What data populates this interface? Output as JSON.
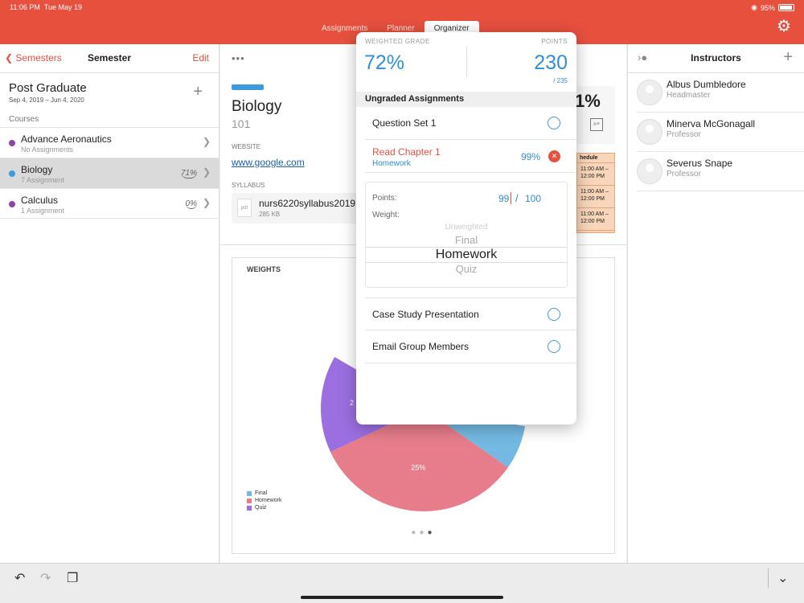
{
  "status": {
    "time": "11:06 PM",
    "date": "Tue May 19",
    "battery": "95%"
  },
  "tabs": [
    {
      "label": "Assignments",
      "active": false
    },
    {
      "label": "Planner",
      "active": false
    },
    {
      "label": "Organizer",
      "active": true
    }
  ],
  "left": {
    "back_label": "Semesters",
    "title": "Semester",
    "edit_label": "Edit",
    "semester_name": "Post Graduate",
    "semester_dates": "Sep 4, 2019 – Jun 4, 2020",
    "courses_header": "Courses",
    "courses": [
      {
        "name": "Advance Aeronautics",
        "sub": "No Assignments",
        "pct": "",
        "color": "#8e44ad",
        "selected": false
      },
      {
        "name": "Biology",
        "sub": "7 Assignment",
        "pct": "71%",
        "color": "#3d9bdc",
        "selected": true
      },
      {
        "name": "Calculus",
        "sub": "1 Assignment",
        "pct": "0%",
        "color": "#8e44ad",
        "selected": false
      }
    ]
  },
  "course": {
    "name": "Biology",
    "number": "101",
    "website_label": "WEBSITE",
    "website": "www.google.com",
    "syllabus_label": "SYLLABUS",
    "file_name": "nurs6220syllabus2019",
    "file_size": "285 KB",
    "file_type": "pdf",
    "grade_partial": "1%",
    "schedule_label": "hedule",
    "schedule_times": [
      "11:00 AM – 12:00 PM",
      "11:00 AM – 12:00 PM",
      "11:00 AM – 12:00 PM"
    ]
  },
  "chart_data": {
    "type": "pie",
    "title": "WEIGHTS",
    "categories": [
      "Final",
      "Homework",
      "Quiz"
    ],
    "colors": [
      "#74b9e3",
      "#e77d8b",
      "#9b6fe0"
    ],
    "slice_labels": [
      "",
      "25%",
      "2"
    ],
    "slices_visible_degrees": {
      "Final": [
        100,
        125
      ],
      "Homework": [
        125,
        245
      ],
      "Quiz": [
        245,
        300
      ]
    }
  },
  "right": {
    "title": "Instructors",
    "instructors": [
      {
        "name": "Albus Dumbledore",
        "role": "Headmaster"
      },
      {
        "name": "Minerva McGonagall",
        "role": "Professor"
      },
      {
        "name": "Severus Snape",
        "role": "Professor"
      }
    ]
  },
  "popover": {
    "weighted_label": "WEIGHTED GRADE",
    "weighted_value": "72%",
    "points_label": "POINTS",
    "points_value": "230",
    "points_total": "/ 235",
    "ungraded_header": "Ungraded Assignments",
    "assignments": [
      {
        "name": "Question Set 1"
      },
      {
        "name": "Read Chapter 1",
        "category": "Homework",
        "pct": "99%",
        "expanded": true
      },
      {
        "name": "Case Study Presentation"
      },
      {
        "name": "Email Group Members"
      }
    ],
    "editor": {
      "points_label": "Points:",
      "weight_label": "Weight:",
      "points_value": "99",
      "slash": "/",
      "points_max": "100",
      "weight_options": [
        "Unweighted",
        "Final",
        "Homework",
        "Quiz"
      ],
      "weight_selected": "Homework"
    }
  }
}
